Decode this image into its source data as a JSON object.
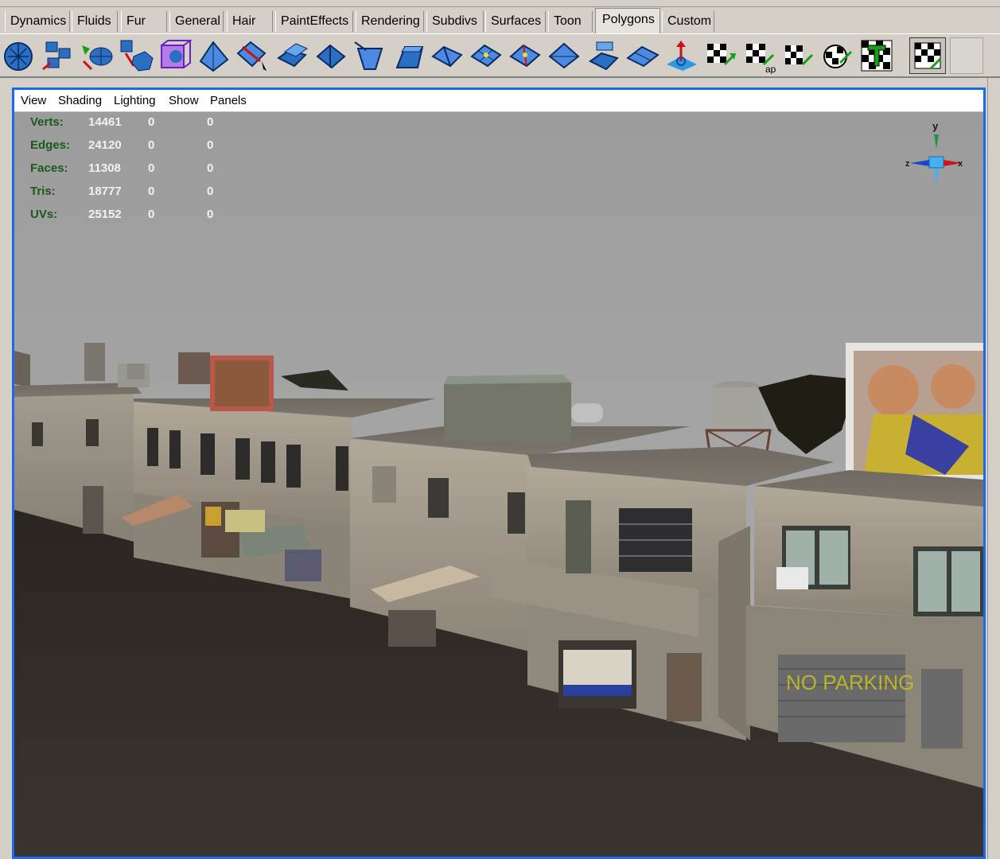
{
  "shelf_tabs": [
    {
      "label": "Dynamics",
      "active": false
    },
    {
      "label": "Fluids",
      "active": false
    },
    {
      "label": "Fur",
      "active": false
    },
    {
      "label": "General",
      "active": false
    },
    {
      "label": "Hair",
      "active": false
    },
    {
      "label": "PaintEffects",
      "active": false
    },
    {
      "label": "Rendering",
      "active": false
    },
    {
      "label": "Subdivs",
      "active": false
    },
    {
      "label": "Surfaces",
      "active": false
    },
    {
      "label": "Toon",
      "active": false
    },
    {
      "label": "Polygons",
      "active": true
    },
    {
      "label": "Custom",
      "active": false
    }
  ],
  "viewport": {
    "menus": [
      "View",
      "Shading",
      "Lighting",
      "Show",
      "Panels"
    ],
    "hud": [
      {
        "label": "Verts:",
        "v1": "14461",
        "v2": "0",
        "v3": "0"
      },
      {
        "label": "Edges:",
        "v1": "24120",
        "v2": "0",
        "v3": "0"
      },
      {
        "label": "Faces:",
        "v1": "11308",
        "v2": "0",
        "v3": "0"
      },
      {
        "label": "Tris:",
        "v1": "18777",
        "v2": "0",
        "v3": "0"
      },
      {
        "label": "UVs:",
        "v1": "25152",
        "v2": "0",
        "v3": "0"
      }
    ],
    "axis_labels": {
      "y": "y",
      "x": "x",
      "z": "z"
    },
    "scene_text": {
      "graffiti": "NO PARKING"
    }
  },
  "colors": {
    "panel_border": "#1a6af0",
    "sky": "#a7a7a7",
    "ground": "#2f2a24",
    "hud_label": "#1a5a1a",
    "hud_value": "#f2f2f2"
  }
}
